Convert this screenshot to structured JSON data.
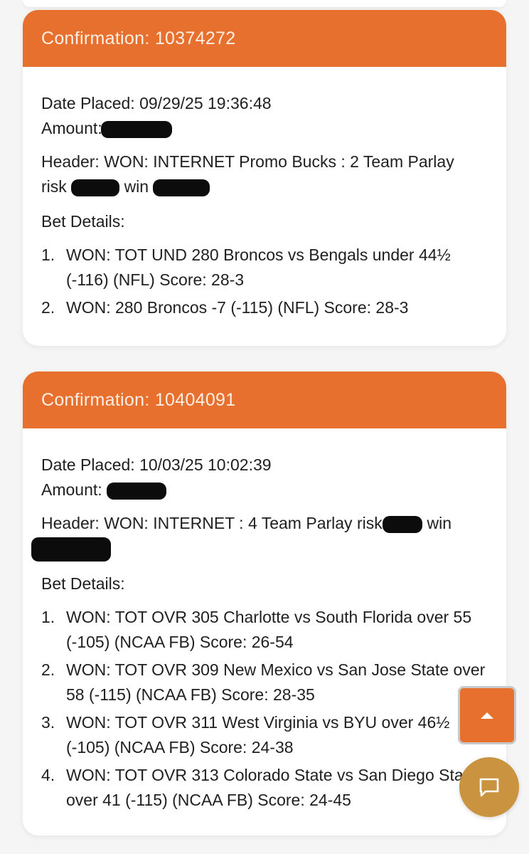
{
  "colors": {
    "accent": "#e8702e",
    "chat": "#c99340",
    "background": "#f5f5f5"
  },
  "cards": [
    {
      "confirmation_label": "Confirmation:",
      "confirmation_number": "10374272",
      "date_label": "Date Placed:",
      "date_value": "09/29/25 19:36:48",
      "amount_label": "Amount:",
      "header_label": "Header:",
      "header_text": "WON: INTERNET Promo Bucks : 2 Team Parlay",
      "header_risk_word": "risk",
      "header_win_word": "win",
      "bet_details_label": "Bet Details:",
      "bets": [
        {
          "num": "1.",
          "text": "WON: TOT UND 280 Broncos vs Bengals under 44½ (-116) (NFL) Score: 28-3"
        },
        {
          "num": "2.",
          "text": "WON: 280 Broncos -7 (-115) (NFL) Score: 28-3"
        }
      ]
    },
    {
      "confirmation_label": "Confirmation:",
      "confirmation_number": "10404091",
      "date_label": "Date Placed:",
      "date_value": "10/03/25 10:02:39",
      "amount_label": "Amount:",
      "header_label": "Header:",
      "header_text": "WON: INTERNET : 4 Team Parlay risk",
      "header_win_word": "win",
      "bet_details_label": "Bet Details:",
      "bets": [
        {
          "num": "1.",
          "text": "WON: TOT OVR 305 Charlotte vs South Florida over 55 (-105) (NCAA FB) Score: 26-54"
        },
        {
          "num": "2.",
          "text": "WON: TOT OVR 309 New Mexico vs San Jose State over 58 (-115) (NCAA FB) Score: 28-35"
        },
        {
          "num": "3.",
          "text": "WON: TOT OVR 311 West Virginia vs BYU over 46½ (-105) (NCAA FB) Score: 24-38"
        },
        {
          "num": "4.",
          "text": "WON: TOT OVR 313 Colorado State vs San Diego State over 41 (-115) (NCAA FB) Score: 24-45"
        }
      ]
    }
  ],
  "icons": {
    "scroll_top": "caret-up-icon",
    "chat": "chat-bubble-icon"
  }
}
